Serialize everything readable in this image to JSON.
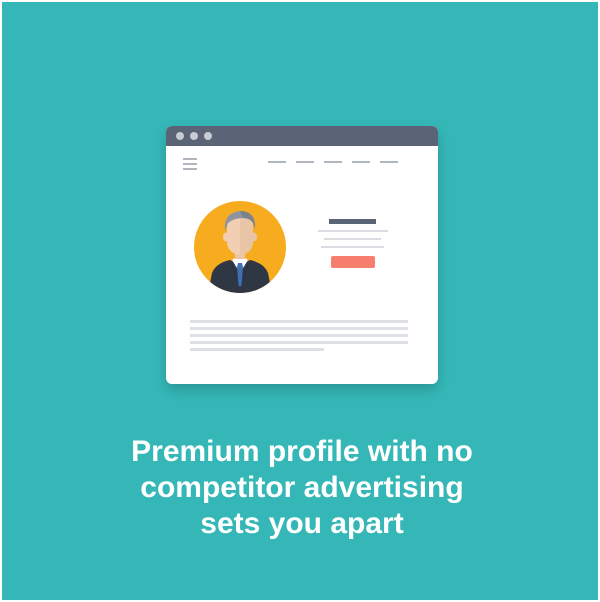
{
  "illustration": {
    "window_dots": [
      "dot",
      "dot",
      "dot"
    ],
    "menu_icon": "hamburger-icon",
    "avatar_icon": "businessman-avatar-icon",
    "colors": {
      "background": "#35b7b8",
      "titlebar": "#5b6476",
      "avatar_circle": "#f7ac1f",
      "suit": "#2f3745",
      "tie": "#3f6fb5",
      "button": "#f57f6c",
      "line_gray": "#d9dde2"
    }
  },
  "headline": {
    "line1": "Premium profile with no",
    "line2": "competitor advertising",
    "line3": "sets you apart"
  }
}
